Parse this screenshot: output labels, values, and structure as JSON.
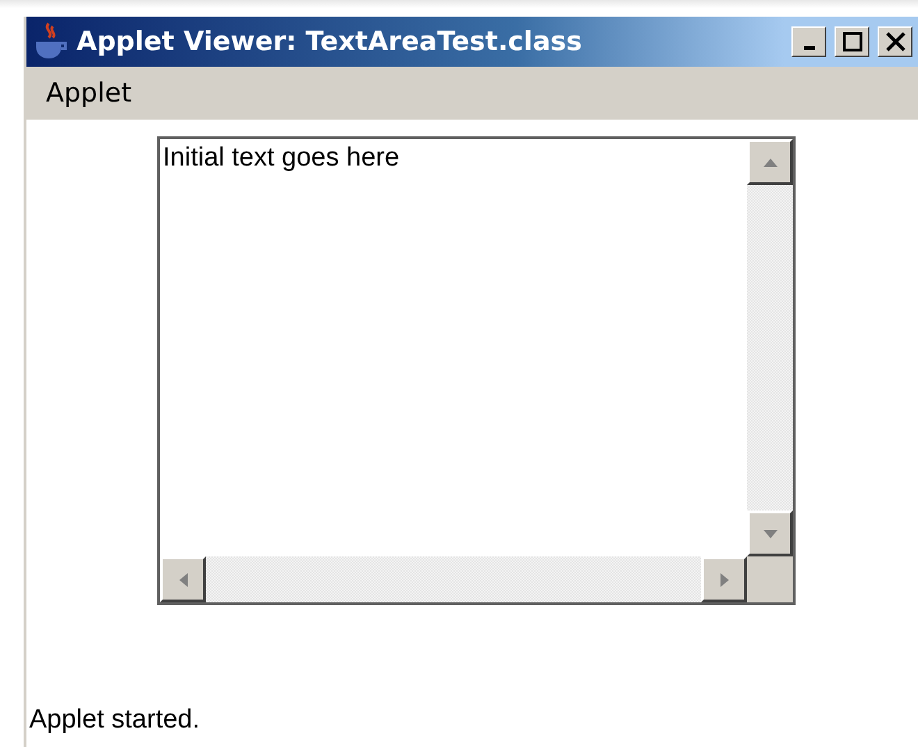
{
  "window": {
    "title": "Applet Viewer: TextAreaTest.class"
  },
  "menu_bar": {
    "items": [
      "Applet"
    ]
  },
  "text_area": {
    "value": "Initial text goes here"
  },
  "status_bar": {
    "text": "Applet started."
  }
}
